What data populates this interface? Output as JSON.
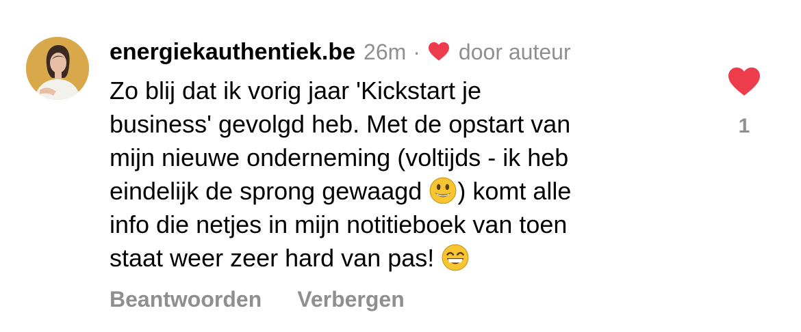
{
  "comment": {
    "username": "energiekauthentiek.be",
    "time": "26m",
    "separator": "·",
    "author_like_label": "door auteur",
    "lines": [
      {
        "text": "Zo blij dat ik vorig jaar 'Kickstart je",
        "after": ""
      },
      {
        "text": "business' gevolgd heb. Met de opstart van",
        "after": ""
      },
      {
        "text": "mijn nieuwe onderneming (voltijds - ik heb",
        "after": ""
      },
      {
        "text": "eindelijk de sprong gewaagd ",
        "after": ") komt alle"
      },
      {
        "text": "info die netjes in mijn notitieboek van toen",
        "after": ""
      },
      {
        "text": "staat weer zeer hard van pas! ",
        "after": ""
      }
    ],
    "emojis": [
      "smiley-emoji",
      "grinning-emoji"
    ]
  },
  "actions": {
    "reply_label": "Beantwoorden",
    "hide_label": "Verbergen"
  },
  "likes": {
    "count": "1",
    "icon": "heart-filled-icon"
  },
  "colors": {
    "heart": "#ed3c4b",
    "muted": "#8e8e93",
    "avatar_bg": "#d9a84a"
  }
}
